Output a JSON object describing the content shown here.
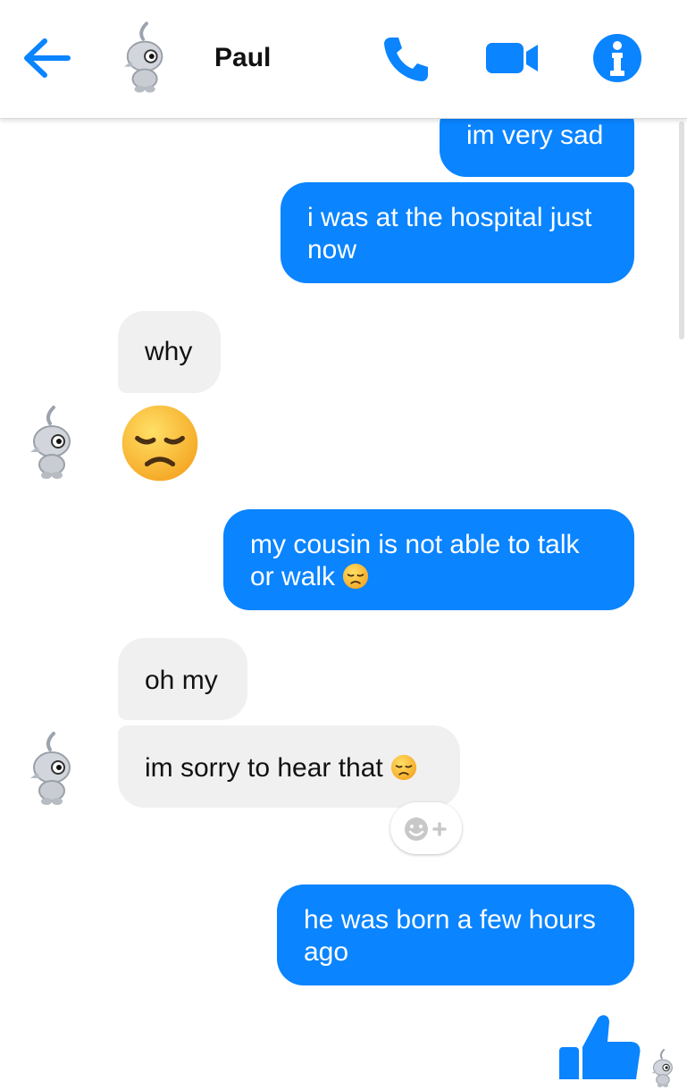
{
  "header": {
    "contact_name": "Paul",
    "back_icon": "arrow-left-icon",
    "call_icon": "phone-icon",
    "video_icon": "video-camera-icon",
    "info_icon": "info-icon"
  },
  "colors": {
    "accent": "#0a84ff",
    "outgoing_bubble": "#0a84ff",
    "incoming_bubble": "#f0f0f0"
  },
  "messages": [
    {
      "sender": "me",
      "text": "im very sad"
    },
    {
      "sender": "me",
      "line1": "i was at the hospital just",
      "line2": "now"
    },
    {
      "sender": "Paul",
      "text": "why"
    },
    {
      "sender": "Paul",
      "emoji": "disappointed-face"
    },
    {
      "sender": "me",
      "line1": "my cousin is not able to talk",
      "line2": "or walk",
      "emoji": "disappointed-face"
    },
    {
      "sender": "Paul",
      "text": "oh my"
    },
    {
      "sender": "Paul",
      "text": "im sorry to hear that",
      "emoji": "disappointed-face"
    },
    {
      "sender": "me",
      "line1": "he was born a few hours",
      "line2": "ago"
    }
  ],
  "reaction_button_icon": "add-reaction-icon",
  "sent_like_icon": "thumbs-up-icon"
}
